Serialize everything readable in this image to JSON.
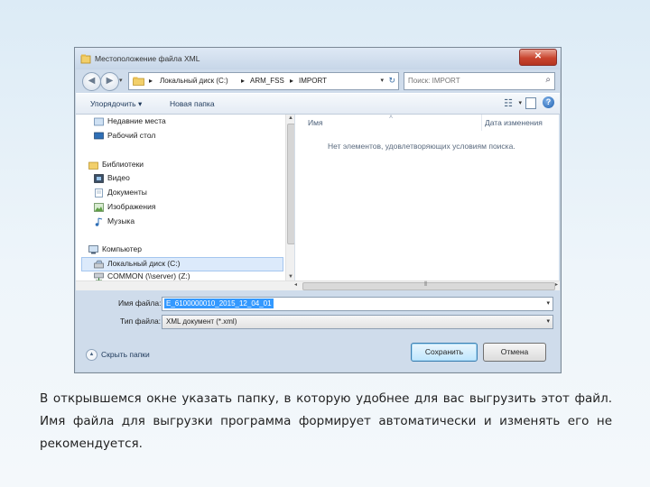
{
  "dialog": {
    "title": "Местоположение файла XML",
    "close_glyph": "✕"
  },
  "address": {
    "crumbs": [
      "Локальный диск (C:)",
      "ARM_FSS",
      "IMPORT"
    ],
    "separator": "▸",
    "dropdown_glyph": "▾",
    "refresh_glyph": "↻",
    "back_glyph": "◀",
    "forward_glyph": "▶"
  },
  "search": {
    "placeholder": "Поиск: IMPORT",
    "icon": "search-icon",
    "glyph": "⌕"
  },
  "toolbar": {
    "organize_label": "Упорядочить ▾",
    "new_folder_label": "Новая папка",
    "view_glyph": "☷",
    "view_drop_glyph": "▾",
    "help_glyph": "?"
  },
  "nav": {
    "items": [
      {
        "label": "Недавние места",
        "icon": "recent-places-icon"
      },
      {
        "label": "Рабочий стол",
        "icon": "desktop-icon"
      },
      {
        "label": "Библиотеки",
        "icon": "libraries-icon"
      },
      {
        "label": "Видео",
        "icon": "video-icon"
      },
      {
        "label": "Документы",
        "icon": "documents-icon"
      },
      {
        "label": "Изображения",
        "icon": "images-icon"
      },
      {
        "label": "Музыка",
        "icon": "music-icon"
      },
      {
        "label": "Компьютер",
        "icon": "computer-icon"
      },
      {
        "label": "Локальный диск (C:)",
        "icon": "local-disk-icon",
        "selected": true
      },
      {
        "label": "COMMON (\\\\server) (Z:)",
        "icon": "network-drive-icon"
      }
    ],
    "scroll_up_glyph": "▲",
    "scroll_down_glyph": "▼"
  },
  "content": {
    "col_name": "Имя",
    "col_date": "Дата изменения",
    "sort_glyph": "˄",
    "empty_message": "Нет элементов, удовлетворяющих условиям поиска."
  },
  "hscroll": {
    "left_glyph": "◂",
    "right_glyph": "▸",
    "grip_glyph": "⦀"
  },
  "form": {
    "filename_label": "Имя файла:",
    "filename_value": "E_6100000010_2015_12_04_01",
    "filetype_label": "Тип файла:",
    "filetype_value": "XML документ (*.xml)",
    "drop_glyph": "▾"
  },
  "footer": {
    "hide_folders_label": "Скрыть папки",
    "hide_folders_glyph": "▲",
    "save_label": "Сохранить",
    "cancel_label": "Отмена"
  },
  "caption": "В открывшемся окне указать папку, в которую удобнее для вас выгрузить этот файл. Имя файла для выгрузки программа формирует автоматически и изменять его не рекомендуется."
}
